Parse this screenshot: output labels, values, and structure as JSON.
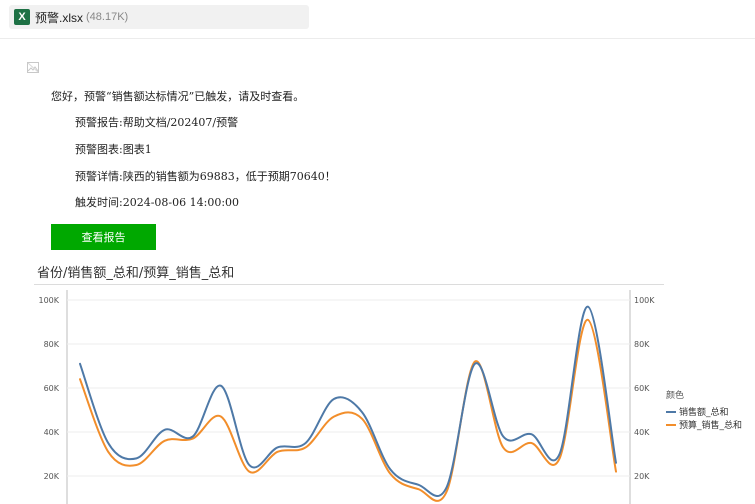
{
  "attachment": {
    "icon": "excel-icon",
    "icon_letter": "X",
    "filename": "预警.xlsx",
    "size": "(48.17K)"
  },
  "email": {
    "greeting": "您好，预警“销售额达标情况”已触发，请及时查看。",
    "report_label": "预警报告:",
    "report_value": "帮助文档/202407/预警",
    "chart_label": "预警图表:",
    "chart_value": "图表1",
    "detail_label": "预警详情:",
    "detail_value": "陕西的销售额为69883，低于预期70640！",
    "time_label": "触发时间:",
    "time_value": "2024-08-06 14:00:00",
    "button_label": "查看报告",
    "button_color": "#00a800"
  },
  "chart": {
    "title": "省份/销售额_总和/预算_销售_总和",
    "legend_title": "颜色"
  },
  "chart_data": {
    "type": "line",
    "title": "省份/销售额_总和/预算_销售_总和",
    "y_ticks": [
      "20K",
      "40K",
      "60K",
      "80K",
      "100K"
    ],
    "ylim": [
      10000,
      100000
    ],
    "grid": true,
    "legend_position": "right",
    "series": [
      {
        "name": "销售额_总和",
        "color": "#4e79a7",
        "values": [
          71000,
          35000,
          28000,
          41000,
          38000,
          61000,
          25000,
          33000,
          35000,
          55000,
          49000,
          23000,
          16000,
          15000,
          71000,
          38000,
          39000,
          30000,
          97000,
          26000
        ]
      },
      {
        "name": "预算_销售_总和",
        "color": "#f28e2b",
        "values": [
          64000,
          31000,
          25000,
          36000,
          37000,
          47000,
          22000,
          31000,
          33000,
          47000,
          46000,
          21000,
          14000,
          13000,
          72000,
          33000,
          35000,
          28000,
          91000,
          22000
        ]
      }
    ]
  }
}
